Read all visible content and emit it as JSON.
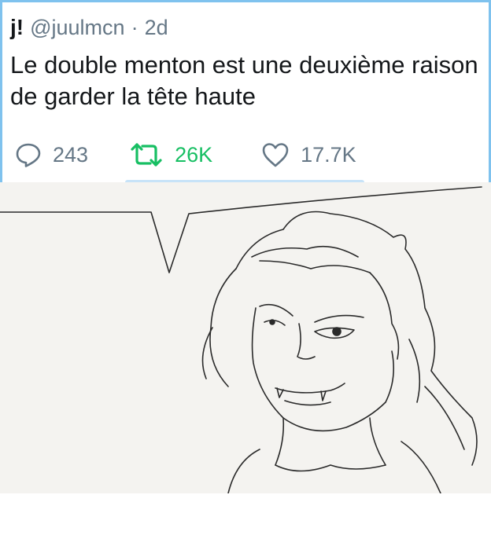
{
  "tweet": {
    "display_name": "j!",
    "handle": "@juulmcn",
    "separator": "·",
    "age": "2d",
    "text": "Le double menton est une deuxième raison de garder la tête haute"
  },
  "actions": {
    "replies": {
      "icon": "reply-bubble-icon",
      "count": "243"
    },
    "retweets": {
      "icon": "retweet-icon",
      "count": "26K"
    },
    "likes": {
      "icon": "heart-icon",
      "count": "17.7K"
    }
  },
  "colors": {
    "card_border": "#7fc2ee",
    "retweet_active": "#17bf63",
    "muted_text": "#657786",
    "text": "#14171a"
  }
}
